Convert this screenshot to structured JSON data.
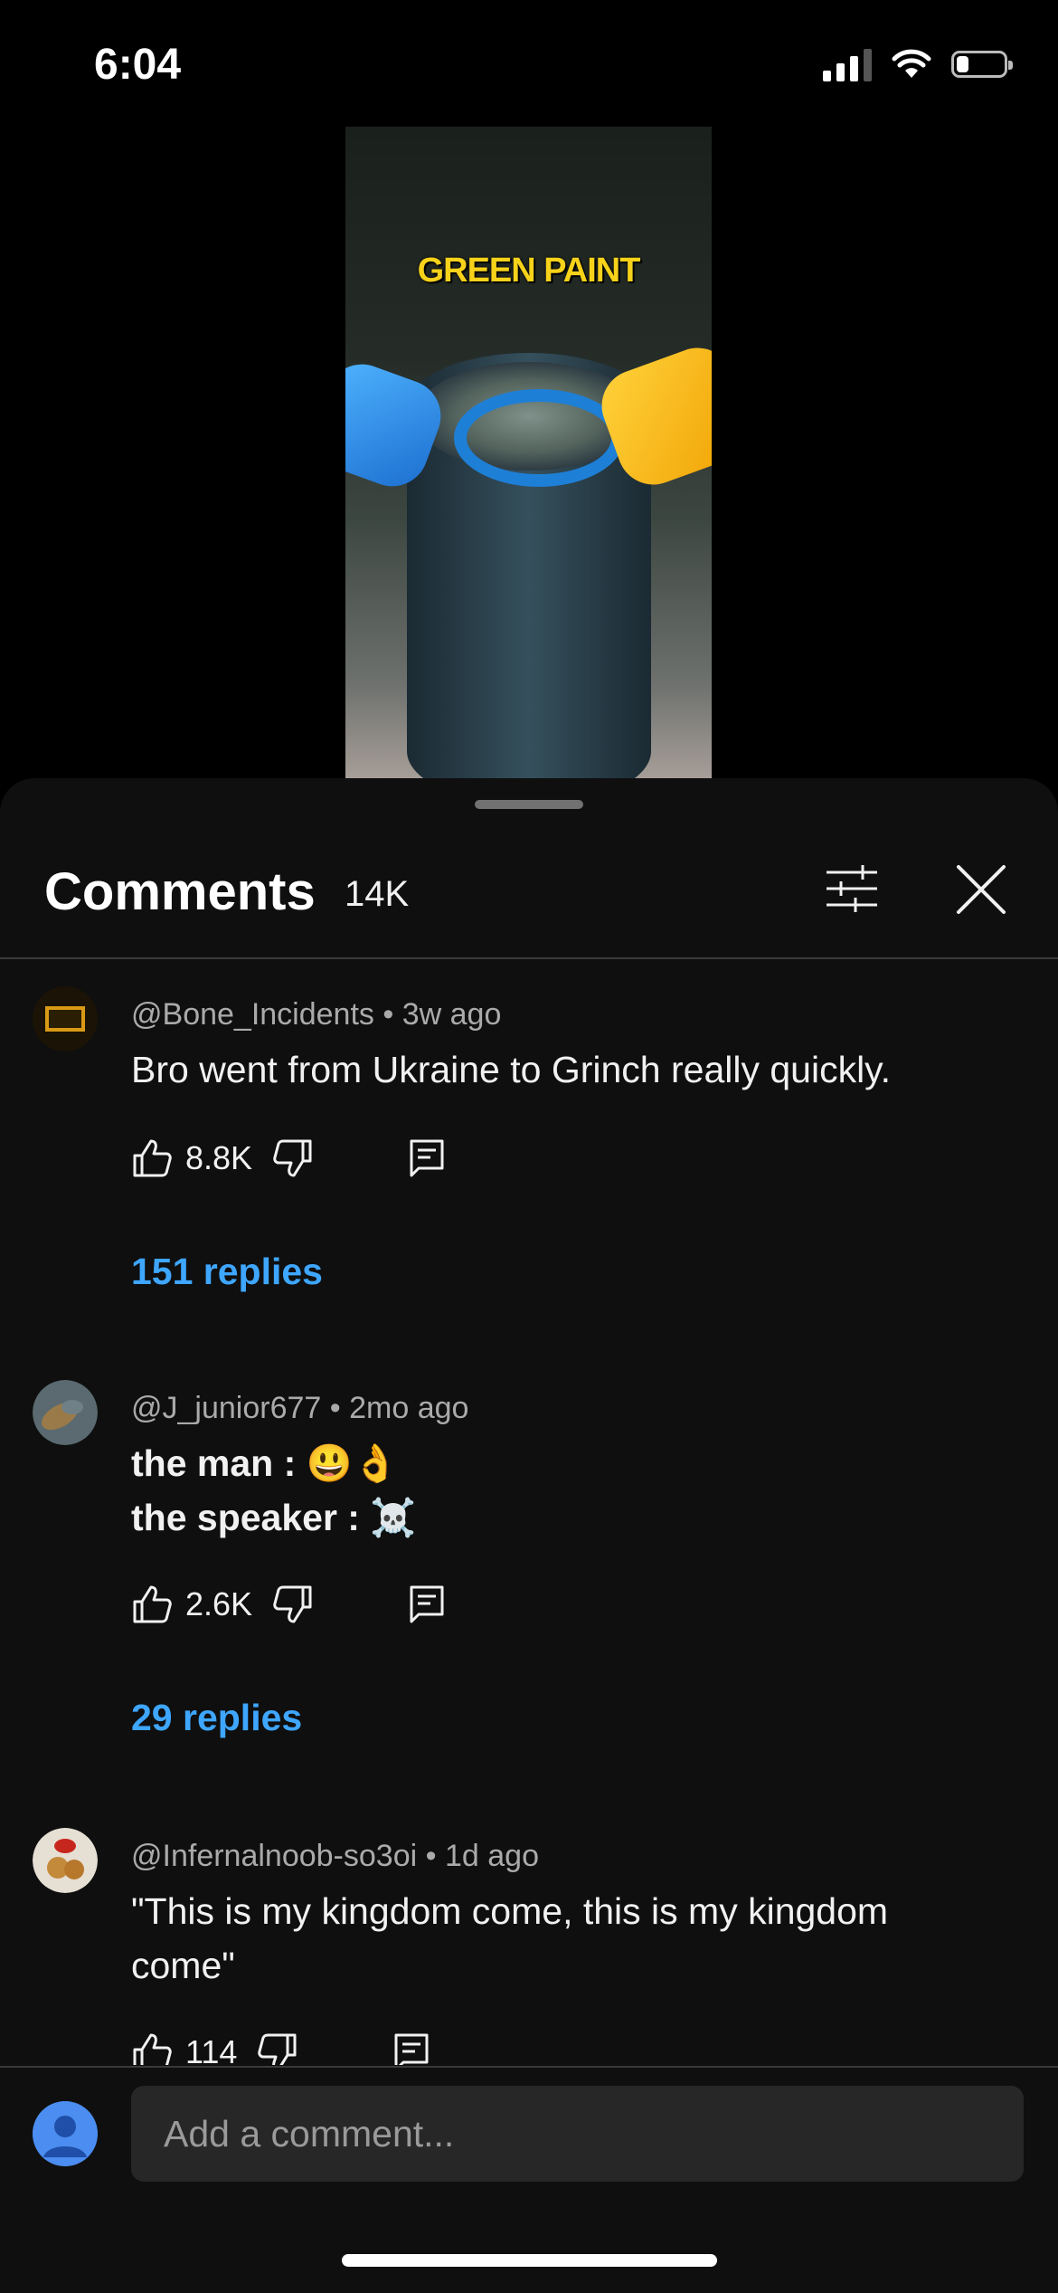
{
  "status_bar": {
    "time": "6:04"
  },
  "video": {
    "overlay_text": "GREEN PAINT"
  },
  "comments_sheet": {
    "title": "Comments",
    "count": "14K",
    "comments": [
      {
        "author": "@Bone_Incidents",
        "age": "3w ago",
        "text_lines": [
          "Bro went from Ukraine to Grinch really quickly."
        ],
        "likes": "8.8K",
        "replies": "151 replies"
      },
      {
        "author": "@J_junior677",
        "age": "2mo ago",
        "text_lines": [
          "the man : 😃👌",
          "the speaker : ☠️"
        ],
        "likes": "2.6K",
        "replies": "29 replies"
      },
      {
        "author": "@Infernalnoob-so3oi",
        "age": "1d ago",
        "text_lines": [
          "\"This is my kingdom come, this is my kingdom",
          "come\""
        ],
        "likes": "114",
        "replies": ""
      }
    ]
  },
  "input": {
    "placeholder": "Add a comment..."
  },
  "colors": {
    "accent_link": "#3ea6ff",
    "sheet_bg": "#0f0f0f",
    "input_bg": "#272727"
  },
  "icons": [
    "signal-icon",
    "wifi-icon",
    "battery-icon",
    "filter-icon",
    "close-icon",
    "like-icon",
    "dislike-icon",
    "reply-icon",
    "user-avatar-icon"
  ]
}
